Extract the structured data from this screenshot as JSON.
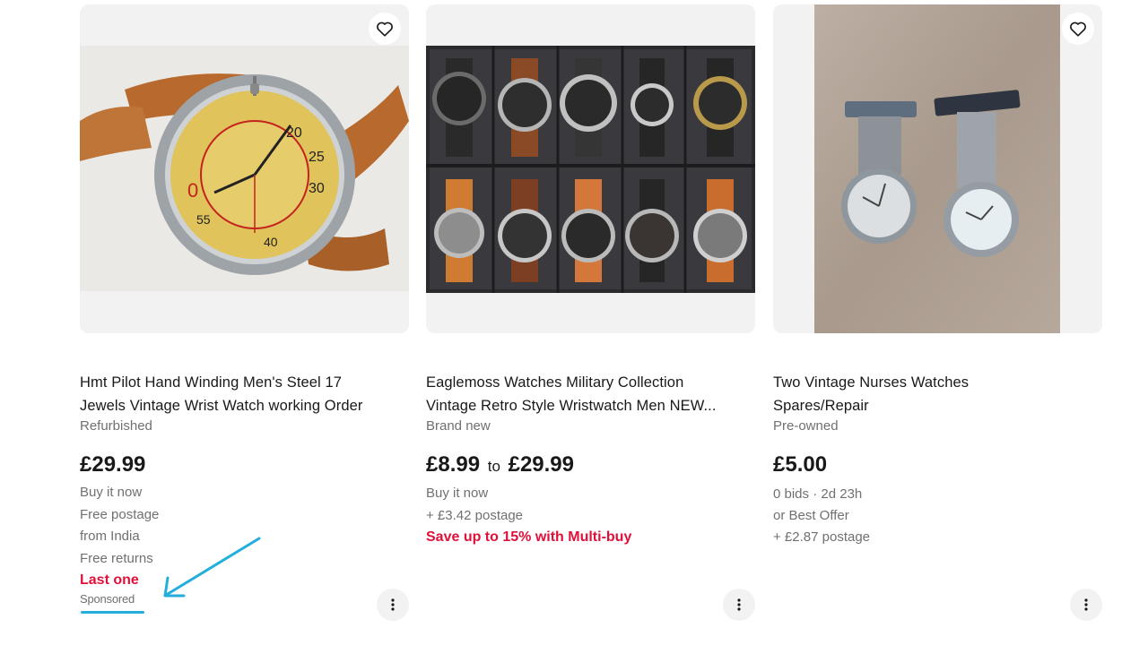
{
  "listings": [
    {
      "title_line1": "Hmt Pilot Hand Winding Men's Steel 17",
      "title_line2": "Jewels Vintage Wrist Watch working Order",
      "condition": "Refurbished",
      "price": "£29.99",
      "meta": [
        "Buy it now",
        "Free postage",
        "from India",
        "Free returns"
      ],
      "highlight": "Last one",
      "sponsored": "Sponsored",
      "image_icon": "yellow-dial-pilot-watch-image"
    },
    {
      "title_line1": "Eaglemoss Watches Military Collection",
      "title_line2": "Vintage Retro Style Wristwatch Men NEW...",
      "condition": "Brand new",
      "price_from": "£8.99",
      "price_to_word": "to",
      "price_to": "£29.99",
      "meta": [
        "Buy it now",
        "+ £3.42 postage"
      ],
      "highlight": "Save up to 15% with Multi-buy",
      "image_icon": "watch-collection-box-image"
    },
    {
      "title_line1": "Two Vintage Nurses Watches",
      "title_line2": "Spares/Repair",
      "condition": "Pre-owned",
      "price": "£5.00",
      "bids": "0 bids",
      "time_left": "2d 23h",
      "meta": [
        "or Best Offer",
        "+ £2.87 postage"
      ],
      "image_icon": "nurse-fob-watches-image"
    }
  ],
  "colors": {
    "accent_red": "#e0103a",
    "annotation_blue": "#23aedc",
    "muted_text": "#707070"
  }
}
